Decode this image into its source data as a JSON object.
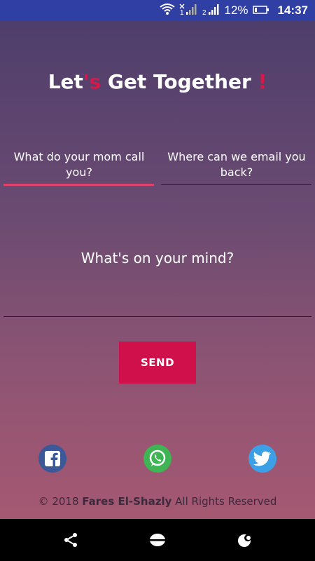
{
  "status_bar": {
    "battery_percent": "12%",
    "time": "14:37",
    "network_label": "1",
    "sim_label": "2",
    "icons": [
      "wifi-icon",
      "signal-1-icon",
      "signal-2-icon",
      "battery-icon"
    ]
  },
  "page": {
    "title_parts": [
      "Let",
      "'s",
      " Get Together ",
      "!"
    ],
    "fields": {
      "name_label": "What do your mom call you?",
      "email_label": "Where can we email you back?",
      "message_label": "What's on your mind?"
    },
    "send_label": "SEND",
    "social": [
      {
        "name": "facebook",
        "color": "#3B5898"
      },
      {
        "name": "whatsapp",
        "color": "#3EB453"
      },
      {
        "name": "twitter",
        "color": "#3D9FE6"
      }
    ],
    "footer": {
      "prefix": "© 2018 ",
      "author": "Fares El-Shazly",
      "suffix": " All Rights Reserved"
    }
  },
  "colors": {
    "status_bar_bg": "#2F3FA3",
    "accent": "#D0104A",
    "active_underline": "#E0426E",
    "nav_bg": "#000000"
  },
  "nav_bar": {
    "icons": [
      "share-icon",
      "home-circle-icon",
      "recent-apps-icon"
    ]
  }
}
